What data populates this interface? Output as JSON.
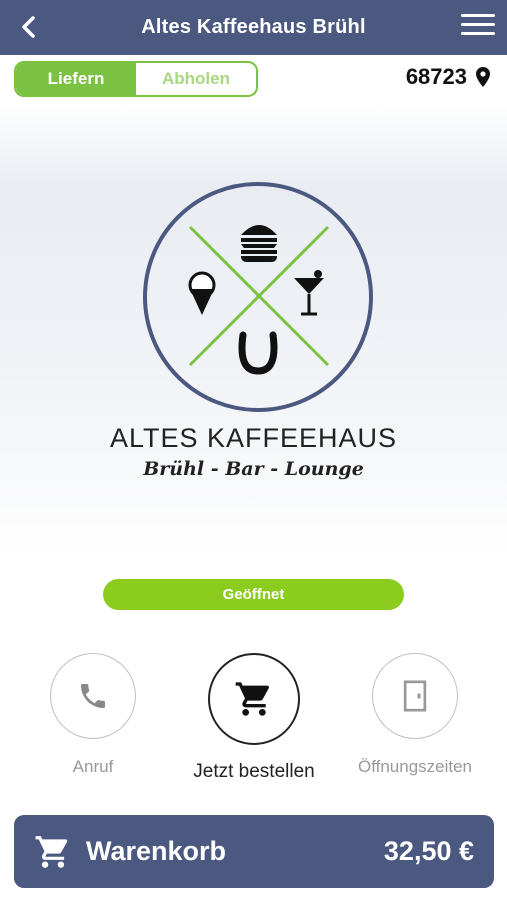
{
  "header": {
    "title": "Altes Kaffeehaus Brühl",
    "back_icon": "chevron-left-icon",
    "menu_icon": "hamburger-menu-icon"
  },
  "delivery_toggle": {
    "options": [
      {
        "label": "Liefern",
        "active": true
      },
      {
        "label": "Abholen",
        "active": false
      }
    ]
  },
  "location": {
    "zip": "68723",
    "icon": "location-pin-icon"
  },
  "logo": {
    "name": "ALTES KAFFEEHAUS",
    "subtitle": "Brühl - Bar - Lounge"
  },
  "status": {
    "label": "Geöffnet",
    "color": "#8bcc1e"
  },
  "actions": [
    {
      "label": "Anruf",
      "icon": "phone-icon"
    },
    {
      "label": "Jetzt bestellen",
      "icon": "shopping-cart-icon"
    },
    {
      "label": "Öffnungszeiten",
      "icon": "door-icon"
    }
  ],
  "cart": {
    "label": "Warenkorb",
    "total": "32,50 €",
    "icon": "shopping-cart-icon"
  },
  "colors": {
    "header": "#4b5880",
    "accent_green": "#7cc242",
    "logo_ring": "#4b5880",
    "logo_cross": "#7cc242"
  }
}
